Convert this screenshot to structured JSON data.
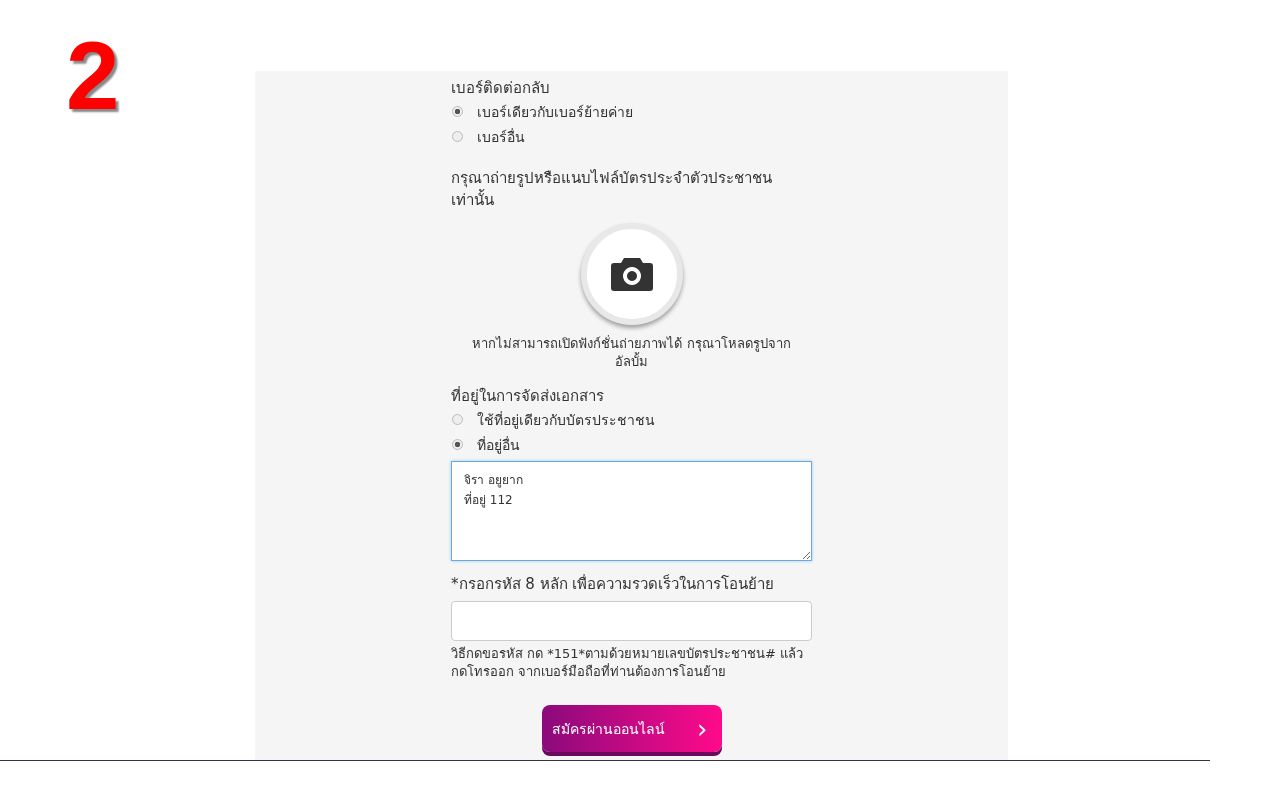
{
  "step_number": "2",
  "contact_number": {
    "label": "เบอร์ติดต่อกลับ",
    "options": [
      {
        "label": "เบอร์เดียวกับเบอร์ย้ายค่าย",
        "selected": true
      },
      {
        "label": "เบอร์อื่น",
        "selected": false
      }
    ]
  },
  "id_photo": {
    "label": "กรุณาถ่ายรูปหรือแนบไฟล์บัตรประจำตัวประชาชนเท่านั้น",
    "hint": "หากไม่สามารถเปิดฟังก์ชั่นถ่ายภาพได้ กรุณาโหลดรูปจาก อัลบั้ม"
  },
  "delivery_address": {
    "label": "ที่อยู่ในการจัดส่งเอกสาร",
    "options": [
      {
        "label": "ใช้ที่อยู่เดียวกับบัตรประชาชน",
        "selected": false
      },
      {
        "label": "ที่อยู่อื่น",
        "selected": true
      }
    ],
    "value": "จิรา อยูยาก\nที่อยู่ 112"
  },
  "code": {
    "label": "*กรอกรหัส 8 หลัก เพื่อความรวดเร็วในการโอนย้าย",
    "help": "วิธีกดขอรหัส กด *151*ตามด้วยหมายเลขบัตรประชาชน# แล้ว กดโทรออก จากเบอร์มือถือที่ท่านต้องการโอนย้าย"
  },
  "submit_button": {
    "label": "สมัครผ่านออนไลน์",
    "icon": "›"
  }
}
